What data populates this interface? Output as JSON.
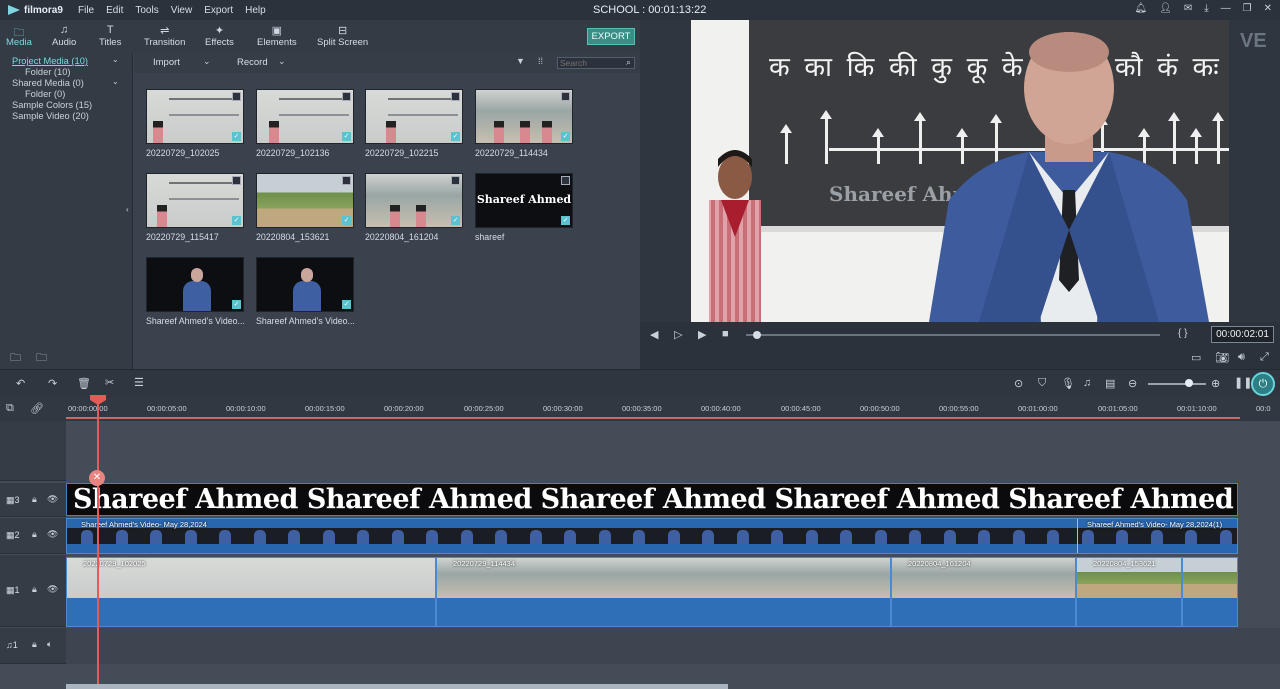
{
  "app": {
    "name": "filmora9",
    "project_title": "SCHOOL : 00:01:13:22"
  },
  "menu": [
    "File",
    "Edit",
    "Tools",
    "View",
    "Export",
    "Help"
  ],
  "tabs": [
    {
      "label": "Media",
      "icon": "folder-icon"
    },
    {
      "label": "Audio",
      "icon": "music-note-icon"
    },
    {
      "label": "Titles",
      "icon": "text-icon"
    },
    {
      "label": "Transition",
      "icon": "transition-icon"
    },
    {
      "label": "Effects",
      "icon": "effects-icon"
    },
    {
      "label": "Elements",
      "icon": "elements-icon"
    },
    {
      "label": "Split Screen",
      "icon": "split-screen-icon"
    }
  ],
  "export_label": "EXPORT",
  "sidebar": {
    "items": [
      {
        "label": "Project Media (10)"
      },
      {
        "label": "Folder (10)"
      },
      {
        "label": "Shared Media (0)"
      },
      {
        "label": "Folder (0)"
      },
      {
        "label": "Sample Colors (15)"
      },
      {
        "label": "Sample Video (20)"
      }
    ]
  },
  "media_header": {
    "import_label": "Import",
    "record_label": "Record",
    "search_placeholder": "Search"
  },
  "media": [
    {
      "name": "20220729_102025",
      "kind": "board"
    },
    {
      "name": "20220729_102136",
      "kind": "board"
    },
    {
      "name": "20220729_102215",
      "kind": "board"
    },
    {
      "name": "20220729_114434",
      "kind": "kids"
    },
    {
      "name": "20220729_115417",
      "kind": "board"
    },
    {
      "name": "20220804_153621",
      "kind": "field"
    },
    {
      "name": "20220804_161204",
      "kind": "kids"
    },
    {
      "name": "shareef",
      "kind": "title",
      "title_text": "Shareef Ahmed"
    },
    {
      "name": "Shareef Ahmed's Video...",
      "kind": "dark"
    },
    {
      "name": "Shareef Ahmed's Video...",
      "kind": "dark"
    }
  ],
  "preview": {
    "hindi_text": "क का कि की कु कू के कै को कौ कं कः",
    "watermark_name": "Shareef Ahmed",
    "timecode": "00:00:02:01",
    "brace_label": "{ }"
  },
  "ruler_ticks": [
    "00:00:00:00",
    "00:00:05:00",
    "00:00:10:00",
    "00:00:15:00",
    "00:00:20:00",
    "00:00:25:00",
    "00:00:30:00",
    "00:00:35:00",
    "00:00:40:00",
    "00:00:45:00",
    "00:00:50:00",
    "00:00:55:00",
    "00:01:00:00",
    "00:01:05:00",
    "00:01:10:00",
    "00:0"
  ],
  "tracks": [
    {
      "label": "3",
      "title_clip": "Shareef Ahmed Shareef Ahmed Shareef Ahmed Shareef Ahmed Shareef Ahmed"
    },
    {
      "label": "2",
      "pip_clip_1": "Shareef Ahmed's Video- May 28,2024",
      "pip_clip_2": "Shareef Ahmed's Video- May 28,2024(1)"
    },
    {
      "label": "1",
      "clips": [
        "20220729_102025",
        "20220729_114434",
        "20220804_161204",
        "20220804_153621",
        ""
      ]
    },
    {
      "label": "1"
    }
  ],
  "zoom_level_fraction": 0.7
}
